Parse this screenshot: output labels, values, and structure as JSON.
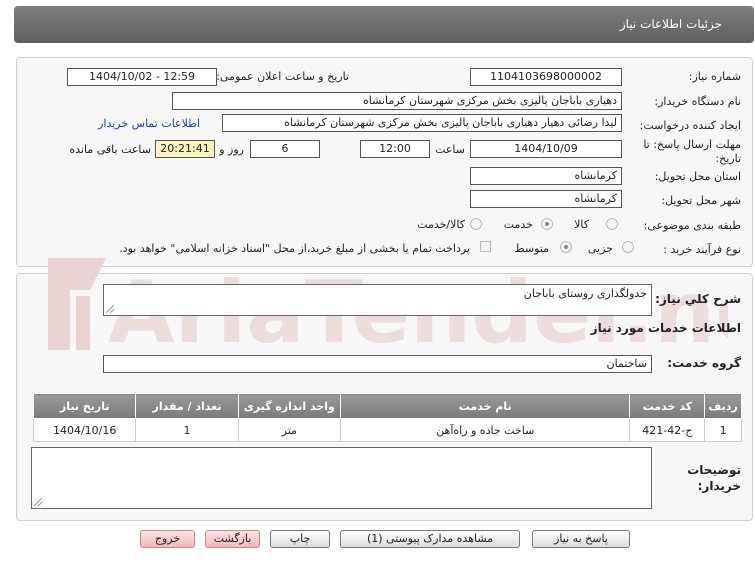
{
  "header": {
    "title": "جزئیات اطلاعات نیاز"
  },
  "form": {
    "need_number_label": "شماره نیاز:",
    "need_number": "1104103698000002",
    "announce_label": "تاریخ و ساعت اعلان عمومی:",
    "announce_value": "1404/10/02 - 12:59",
    "buyer_org_label": "نام دستگاه خریدار:",
    "buyer_org": "دهیاری باباجان پالیزی بخش مرکزی شهرستان کرمانشاه",
    "requester_label": "ایجاد کننده درخواست:",
    "requester": "لیدا رضائی دهیار دهیاری باباجان پالیزی بخش مرکزی شهرستان کرمانشاه",
    "contact_link": "اطلاعات تماس خریدار",
    "deadline_label": "مهلت ارسال پاسخ: تا تاریخ:",
    "deadline_date": "1404/10/09",
    "time_label": "ساعت",
    "deadline_time": "12:00",
    "days_value": "6",
    "days_label": "روز و",
    "remaining_time": "20:21:41",
    "remaining_label": "ساعت باقی مانده",
    "province_label": "استان محل تحویل:",
    "province": "کرمانشاه",
    "city_label": "شهر محل تحویل:",
    "city": "کرمانشاه",
    "category_label": "طبقه بندی موضوعی:",
    "category_options": [
      "کالا",
      "خدمت",
      "کالا/خدمت"
    ],
    "process_label": "نوع فرآیند خرید :",
    "process_options": [
      "جزیی",
      "متوسط"
    ],
    "payment_note": "پرداخت تمام یا بخشی از مبلغ خرید،از محل \"اسناد خزانه اسلامی\" خواهد بود."
  },
  "summary": {
    "label": "شرح کلي نياز:",
    "value": "جدولگذاری روستای باباجان"
  },
  "services": {
    "section_title": "اطلاعات خدمات مورد نیاز",
    "group_label": "گروه خدمت:",
    "group_value": "ساختمان",
    "columns": [
      "ردیف",
      "کد خدمت",
      "نام خدمت",
      "واحد اندازه گیری",
      "تعداد / مقدار",
      "تاریخ نیاز"
    ],
    "rows": [
      [
        "1",
        "ج-42-421",
        "ساخت جاده و راه‌آهن",
        "متر",
        "1",
        "1404/10/16"
      ]
    ]
  },
  "notes": {
    "label": "توضیحات خریدار:"
  },
  "buttons": {
    "reply": "پاسخ به نیاز",
    "attachments": "مشاهده مدارک پیوستی (1)",
    "print": "چاپ",
    "back": "بازگشت",
    "exit": "خروج"
  },
  "watermark": {
    "text": "AriaTender.net"
  },
  "colors": {
    "header": "#6e6e6e",
    "highlight": "#fdf3c0",
    "link": "#1a3ccf",
    "watermark": "#e9d3d3"
  }
}
